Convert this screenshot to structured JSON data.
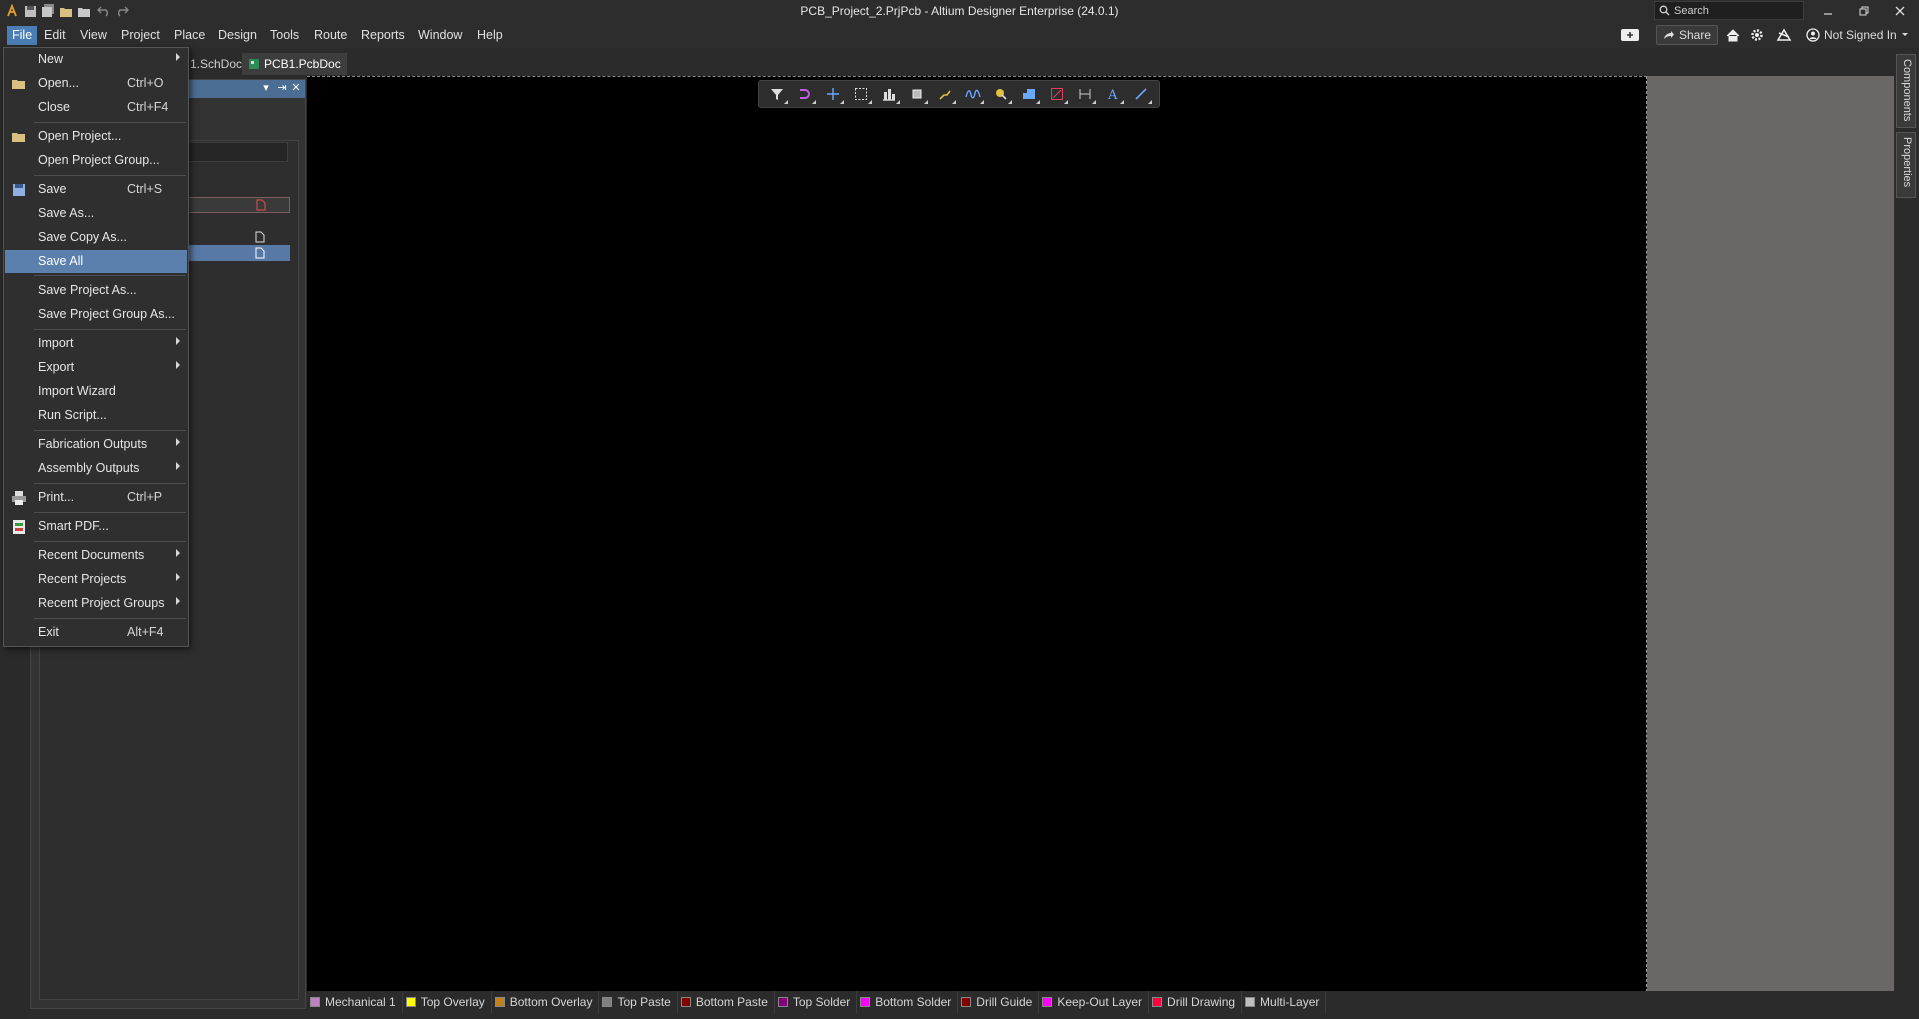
{
  "window": {
    "title": "PCB_Project_2.PrjPcb - Altium Designer Enterprise (24.0.1)",
    "search_placeholder": "Search",
    "signin": "Not Signed In",
    "share": "Share"
  },
  "menubar": {
    "items": [
      "File",
      "Edit",
      "View",
      "Project",
      "Place",
      "Design",
      "Tools",
      "Route",
      "Reports",
      "Window",
      "Help"
    ]
  },
  "tabs": {
    "sch": "1.SchDoc",
    "pcb": "PCB1.PcbDoc"
  },
  "file_menu": {
    "items": [
      {
        "label": "New",
        "shortcut": "",
        "submenu": true
      },
      {
        "label": "Open...",
        "shortcut": "Ctrl+O"
      },
      {
        "label": "Close",
        "shortcut": "Ctrl+F4"
      },
      {
        "label": "Open Project...",
        "shortcut": ""
      },
      {
        "label": "Open Project Group...",
        "shortcut": ""
      },
      {
        "label": "Save",
        "shortcut": "Ctrl+S"
      },
      {
        "label": "Save As...",
        "shortcut": ""
      },
      {
        "label": "Save Copy As...",
        "shortcut": ""
      },
      {
        "label": "Save All",
        "shortcut": ""
      },
      {
        "label": "Save Project As...",
        "shortcut": ""
      },
      {
        "label": "Save Project Group As...",
        "shortcut": ""
      },
      {
        "label": "Import",
        "shortcut": "",
        "submenu": true
      },
      {
        "label": "Export",
        "shortcut": "",
        "submenu": true
      },
      {
        "label": "Import Wizard",
        "shortcut": ""
      },
      {
        "label": "Run Script...",
        "shortcut": ""
      },
      {
        "label": "Fabrication Outputs",
        "shortcut": "",
        "submenu": true
      },
      {
        "label": "Assembly Outputs",
        "shortcut": "",
        "submenu": true
      },
      {
        "label": "Print...",
        "shortcut": "Ctrl+P"
      },
      {
        "label": "Smart PDF...",
        "shortcut": ""
      },
      {
        "label": "Recent Documents",
        "shortcut": "",
        "submenu": true
      },
      {
        "label": "Recent Projects",
        "shortcut": "",
        "submenu": true
      },
      {
        "label": "Recent Project Groups",
        "shortcut": "",
        "submenu": true
      },
      {
        "label": "Exit",
        "shortcut": "Alt+F4"
      }
    ],
    "highlighted": "Save All"
  },
  "right_panels": [
    "Components",
    "Properties"
  ],
  "layers": [
    {
      "name": "Mechanical 1",
      "color": "#c080c0"
    },
    {
      "name": "Top Overlay",
      "color": "#ffff00"
    },
    {
      "name": "Bottom Overlay",
      "color": "#c08020"
    },
    {
      "name": "Top Paste",
      "color": "#808080"
    },
    {
      "name": "Bottom Paste",
      "color": "#800000"
    },
    {
      "name": "Top Solder",
      "color": "#800080"
    },
    {
      "name": "Bottom Solder",
      "color": "#ff00ff"
    },
    {
      "name": "Drill Guide",
      "color": "#800000"
    },
    {
      "name": "Keep-Out Layer",
      "color": "#ff00ff"
    },
    {
      "name": "Drill Drawing",
      "color": "#ff0040"
    },
    {
      "name": "Multi-Layer",
      "color": "#c0c0c0"
    }
  ],
  "colors": {
    "accent": "#4a7eb5",
    "menu_highlight": "#5b80ad",
    "panel_header": "#4d6e94",
    "canvas": "#000000"
  }
}
